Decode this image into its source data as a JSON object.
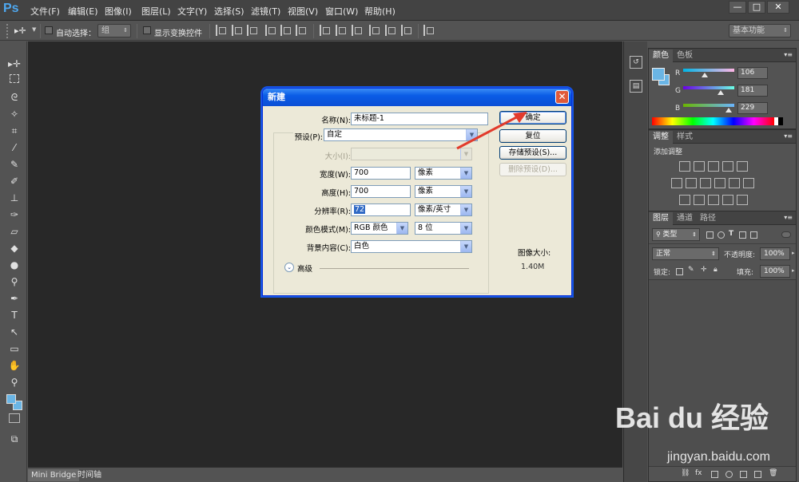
{
  "app": {
    "logo": "Ps",
    "menu": [
      "文件(F)",
      "编辑(E)",
      "图像(I)",
      "图层(L)",
      "文字(Y)",
      "选择(S)",
      "滤镜(T)",
      "视图(V)",
      "窗口(W)",
      "帮助(H)"
    ],
    "window_controls": {
      "minimize": "—",
      "maximize": "□",
      "close": "✕"
    }
  },
  "options_bar": {
    "auto_select_label": "自动选择：",
    "auto_select_value": "组",
    "show_transform_label": "显示变换控件",
    "workspace": "基本功能"
  },
  "bottom_tabs": [
    "Mini Bridge",
    "时间轴"
  ],
  "panels": {
    "color": {
      "tabs": [
        "颜色",
        "色板"
      ],
      "r_label": "R",
      "r_value": "106",
      "g_label": "G",
      "g_value": "181",
      "b_label": "B",
      "b_value": "229",
      "foreground_color": "#6ab5e5"
    },
    "adjustments": {
      "tabs": [
        "调整",
        "样式"
      ],
      "add_label": "添加调整"
    },
    "layers": {
      "tabs": [
        "图层",
        "通道",
        "路径"
      ],
      "filter_kind": "类型",
      "blend_mode": "正常",
      "opacity_label": "不透明度:",
      "opacity_value": "100%",
      "lock_label": "锁定:",
      "fill_label": "填充:",
      "fill_value": "100%"
    }
  },
  "dialog": {
    "title": "新建",
    "close": "✕",
    "name_label": "名称(N):",
    "name_value": "未标题-1",
    "preset_label": "预设(P):",
    "preset_value": "自定",
    "size_label": "大小(I):",
    "width_label": "宽度(W):",
    "width_value": "700",
    "width_unit": "像素",
    "height_label": "高度(H):",
    "height_value": "700",
    "height_unit": "像素",
    "resolution_label": "分辨率(R):",
    "resolution_value": "72",
    "resolution_unit": "像素/英寸",
    "color_mode_label": "颜色模式(M):",
    "color_mode_value": "RGB 颜色",
    "bit_depth_value": "8 位",
    "background_label": "背景内容(C):",
    "background_value": "白色",
    "advanced_label": "高级",
    "ok_button": "确定",
    "reset_button": "复位",
    "save_preset_button": "存储预设(S)...",
    "delete_preset_button": "删除预设(D)...",
    "image_size_label": "图像大小:",
    "image_size_value": "1.40M"
  },
  "watermark": {
    "logo": "Bai du 经验",
    "url": "jingyan.baidu.com"
  }
}
